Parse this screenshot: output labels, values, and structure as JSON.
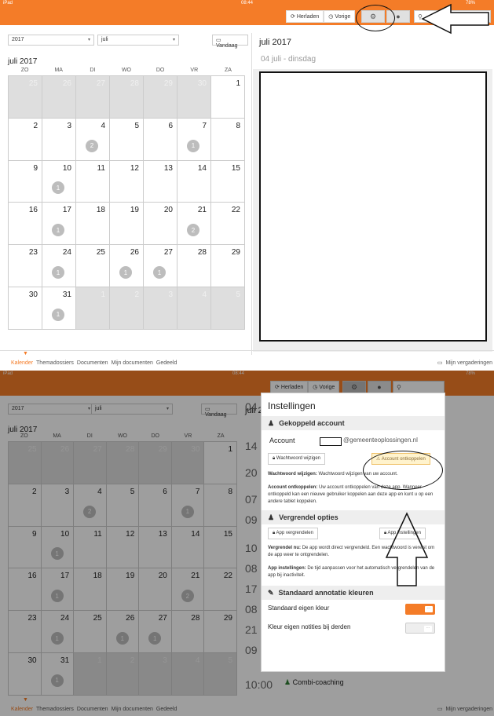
{
  "screen1": {
    "status": {
      "left": "iPad",
      "time": "08:44",
      "battery": "78%"
    },
    "toolbar": {
      "reload": "Herladen",
      "previous": "Vorige",
      "settings_icon": "gear-icon",
      "info_icon": "info-icon",
      "search_placeholder": ""
    },
    "year_select": "2017",
    "month_select": "juli",
    "today_button": "Vandaag",
    "month_title": "juli 2017",
    "weekdays": [
      "ZO",
      "MA",
      "DI",
      "WO",
      "DO",
      "VR",
      "ZA"
    ],
    "weeks": [
      [
        {
          "d": "25",
          "out": true
        },
        {
          "d": "26",
          "out": true
        },
        {
          "d": "27",
          "out": true
        },
        {
          "d": "28",
          "out": true
        },
        {
          "d": "29",
          "out": true
        },
        {
          "d": "30",
          "out": true
        },
        {
          "d": "1"
        }
      ],
      [
        {
          "d": "2"
        },
        {
          "d": "3"
        },
        {
          "d": "4",
          "badge": "2"
        },
        {
          "d": "5"
        },
        {
          "d": "6"
        },
        {
          "d": "7",
          "badge": "1"
        },
        {
          "d": "8"
        }
      ],
      [
        {
          "d": "9"
        },
        {
          "d": "10",
          "badge": "1"
        },
        {
          "d": "11"
        },
        {
          "d": "12"
        },
        {
          "d": "13"
        },
        {
          "d": "14"
        },
        {
          "d": "15"
        }
      ],
      [
        {
          "d": "16"
        },
        {
          "d": "17",
          "badge": "1"
        },
        {
          "d": "18"
        },
        {
          "d": "19"
        },
        {
          "d": "20"
        },
        {
          "d": "21",
          "badge": "2"
        },
        {
          "d": "22"
        }
      ],
      [
        {
          "d": "23"
        },
        {
          "d": "24",
          "badge": "1"
        },
        {
          "d": "25"
        },
        {
          "d": "26",
          "badge": "1"
        },
        {
          "d": "27",
          "badge": "1"
        },
        {
          "d": "28"
        },
        {
          "d": "29"
        }
      ],
      [
        {
          "d": "30"
        },
        {
          "d": "31",
          "badge": "1"
        },
        {
          "d": "1",
          "out": true
        },
        {
          "d": "2",
          "out": true
        },
        {
          "d": "3",
          "out": true
        },
        {
          "d": "4",
          "out": true
        },
        {
          "d": "5",
          "out": true
        }
      ]
    ],
    "right_title": "juli 2017",
    "right_day": "04 juli - dinsdag",
    "nav": [
      "Kalender",
      "Themadossiers",
      "Documenten",
      "Mijn documenten",
      "Gedeeld"
    ],
    "nav_right": "Mijn vergaderingen"
  },
  "screen2": {
    "status": {
      "left": "iPad",
      "time": "08:44",
      "battery": "78%"
    },
    "toolbar": {
      "reload": "Herladen",
      "previous": "Vorige"
    },
    "year_select": "2017",
    "month_select": "juli",
    "today_button": "Vandaag",
    "month_title": "juli 2017",
    "right_title_partial": "juli 2",
    "left_hours": [
      "04",
      "14",
      "20",
      "07",
      "09",
      "10",
      "08",
      "17",
      "08",
      "21",
      "09"
    ],
    "settings": {
      "title": "Instellingen",
      "sec_account": "Gekoppeld account",
      "account_label": "Account",
      "account_value": "@gemeenteoplossingen.nl",
      "btn_change_password": "Wachtwoord wijzigen",
      "btn_disconnect": "Account ontkoppelen",
      "desc_password_bold": "Wachtwoord wijzigen:",
      "desc_password": "Wachtwoord wijzigen van uw account.",
      "desc_disconnect_bold": "Account ontkoppelen:",
      "desc_disconnect": "Uw account ontkoppelen van deze app. Wanneer ontkoppeld kan een nieuwe gebruiker koppelen aan deze app en kunt u op een andere tablet koppelen.",
      "sec_lock": "Vergrendel opties",
      "btn_lock_app": "App vergrendelen",
      "btn_app_settings": "App instellingen",
      "desc_lock_bold": "Vergrendel nu:",
      "desc_lock": "De app wordt direct vergrendeld. Een wachtwoord is vereist om de app weer te ontgrendelen.",
      "desc_appset_bold": "App instellingen:",
      "desc_appset": "De tijd aanpassen voor het automatisch vergrendelen van de app bij inactiviteit.",
      "sec_colors": "Standaard annotatie kleuren",
      "own_color": "Standaard eigen kleur",
      "others_color": "Kleur eigen notities bij derden"
    },
    "event_time": "10:00",
    "event_title": "Combi-coaching",
    "nav": [
      "Kalender",
      "Themadossiers",
      "Documenten",
      "Mijn documenten",
      "Gedeeld"
    ],
    "nav_right": "Mijn vergaderingen"
  },
  "colors": {
    "accent": "#f47c28",
    "muted_cell": "#dedede",
    "badge": "#bdbdbd"
  }
}
